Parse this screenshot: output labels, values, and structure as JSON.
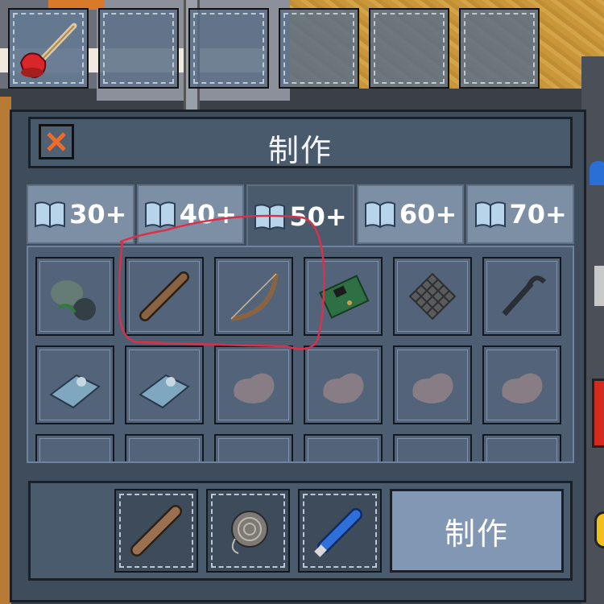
{
  "hotbar": {
    "slots": [
      {
        "item": "plunger-icon"
      },
      {
        "item": ""
      },
      {
        "item": ""
      },
      {
        "item": ""
      },
      {
        "item": ""
      },
      {
        "item": ""
      }
    ]
  },
  "crafting": {
    "title": "制作",
    "close_icon": "close-x-icon",
    "tabs": [
      {
        "label": "30+",
        "icon": "book-icon",
        "active": false
      },
      {
        "label": "40+",
        "icon": "book-icon",
        "active": false
      },
      {
        "label": "50+",
        "icon": "book-icon",
        "active": true
      },
      {
        "label": "60+",
        "icon": "book-icon",
        "active": false
      },
      {
        "label": "70+",
        "icon": "book-icon",
        "active": false
      }
    ],
    "recipes_row1": [
      "sack-icon",
      "wooden-stick-icon",
      "bow-icon",
      "circuit-board-icon",
      "net-icon",
      "grappling-hook-icon"
    ],
    "recipes_row2": [
      "device-icon",
      "device-icon",
      "toy-icon",
      "toy-icon",
      "toy-icon",
      "toy-icon"
    ],
    "recipes_row3": [
      "partial-icon",
      "partial-icon",
      "partial-icon",
      "partial-icon",
      "partial-icon",
      "partial-icon"
    ],
    "ingredients": [
      "wooden-stick-icon",
      "twine-icon",
      "glue-tube-icon"
    ],
    "craft_button": "制作",
    "colors": {
      "panel": "#3f4c5c",
      "button": "#8297b3",
      "highlight_scribble": "#d9314a"
    }
  }
}
